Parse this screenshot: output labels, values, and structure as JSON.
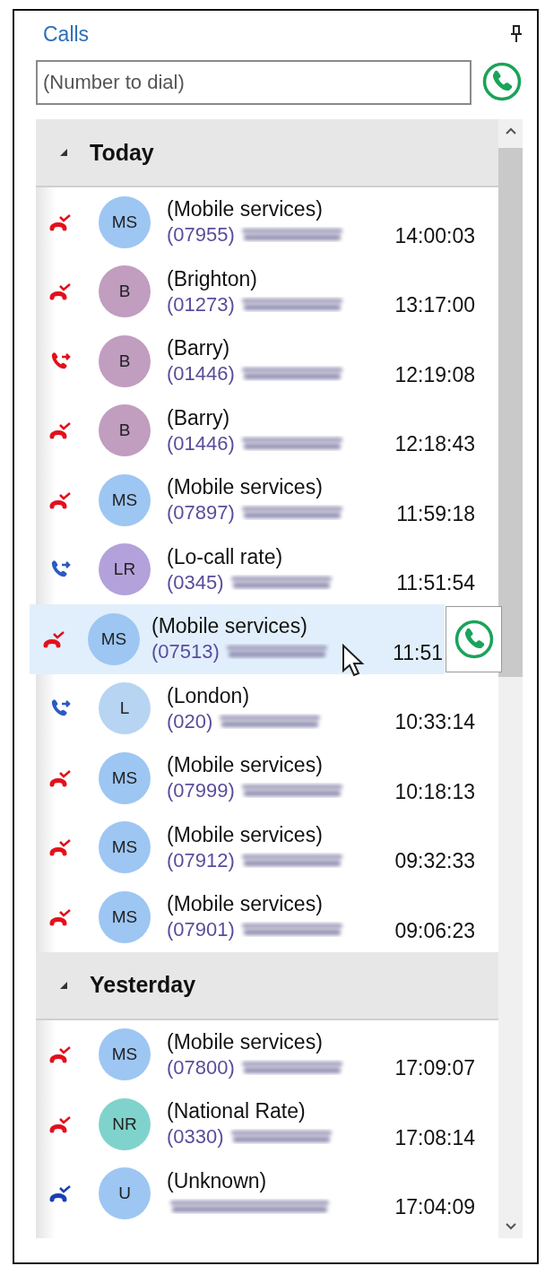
{
  "window": {
    "title": "Calls"
  },
  "dial": {
    "placeholder": "(Number to dial)"
  },
  "groups": [
    {
      "label": "Today",
      "expanded": true,
      "calls": [
        {
          "icon": {
            "kind": "missed",
            "color": "#e3101c"
          },
          "avatar": {
            "initials": "MS",
            "color": "#9dc6f3"
          },
          "name": "(Mobile services)",
          "area_code": "(07955)",
          "time": "14:00:03",
          "selected": false
        },
        {
          "icon": {
            "kind": "missed",
            "color": "#e3101c"
          },
          "avatar": {
            "initials": "B",
            "color": "#c19dc0"
          },
          "name": "(Brighton)",
          "area_code": "(01273)",
          "time": "13:17:00",
          "selected": false
        },
        {
          "icon": {
            "kind": "dialled",
            "color": "#e3101c"
          },
          "avatar": {
            "initials": "B",
            "color": "#c19dc0"
          },
          "name": "(Barry)",
          "area_code": "(01446)",
          "time": "12:19:08",
          "selected": false
        },
        {
          "icon": {
            "kind": "missed",
            "color": "#e3101c"
          },
          "avatar": {
            "initials": "B",
            "color": "#c19dc0"
          },
          "name": "(Barry)",
          "area_code": "(01446)",
          "time": "12:18:43",
          "selected": false
        },
        {
          "icon": {
            "kind": "missed",
            "color": "#e3101c"
          },
          "avatar": {
            "initials": "MS",
            "color": "#9dc6f3"
          },
          "name": "(Mobile services)",
          "area_code": "(07897)",
          "time": "11:59:18",
          "selected": false
        },
        {
          "icon": {
            "kind": "dialled",
            "color": "#2a5bc0"
          },
          "avatar": {
            "initials": "LR",
            "color": "#b3a1dc"
          },
          "name": "(Lo-call rate)",
          "area_code": "(0345)",
          "time": "11:51:54",
          "selected": false
        },
        {
          "icon": {
            "kind": "missed",
            "color": "#e3101c"
          },
          "avatar": {
            "initials": "MS",
            "color": "#9dc6f3"
          },
          "name": "(Mobile services)",
          "area_code": "(07513)",
          "time": "11:51",
          "selected": true
        },
        {
          "icon": {
            "kind": "dialled",
            "color": "#2a5bc0"
          },
          "avatar": {
            "initials": "L",
            "color": "#b7d4f2"
          },
          "name": "(London)",
          "area_code": "(020)",
          "time": "10:33:14",
          "selected": false
        },
        {
          "icon": {
            "kind": "missed",
            "color": "#e3101c"
          },
          "avatar": {
            "initials": "MS",
            "color": "#9dc6f3"
          },
          "name": "(Mobile services)",
          "area_code": "(07999)",
          "time": "10:18:13",
          "selected": false
        },
        {
          "icon": {
            "kind": "missed",
            "color": "#e3101c"
          },
          "avatar": {
            "initials": "MS",
            "color": "#9dc6f3"
          },
          "name": "(Mobile services)",
          "area_code": "(07912)",
          "time": "09:32:33",
          "selected": false
        },
        {
          "icon": {
            "kind": "missed",
            "color": "#e3101c"
          },
          "avatar": {
            "initials": "MS",
            "color": "#9dc6f3"
          },
          "name": "(Mobile services)",
          "area_code": "(07901)",
          "time": "09:06:23",
          "selected": false
        }
      ]
    },
    {
      "label": "Yesterday",
      "expanded": true,
      "calls": [
        {
          "icon": {
            "kind": "missed",
            "color": "#e3101c"
          },
          "avatar": {
            "initials": "MS",
            "color": "#9dc6f3"
          },
          "name": "(Mobile services)",
          "area_code": "(07800)",
          "time": "17:09:07",
          "selected": false
        },
        {
          "icon": {
            "kind": "missed",
            "color": "#e3101c"
          },
          "avatar": {
            "initials": "NR",
            "color": "#80d3cc"
          },
          "name": "(National Rate)",
          "area_code": "(0330)",
          "time": "17:08:14",
          "selected": false
        },
        {
          "icon": {
            "kind": "missed",
            "color": "#1b3fb5"
          },
          "avatar": {
            "initials": "U",
            "color": "#9dc6f3"
          },
          "name": "(Unknown)",
          "time": "17:04:09",
          "selected": false
        }
      ]
    }
  ]
}
